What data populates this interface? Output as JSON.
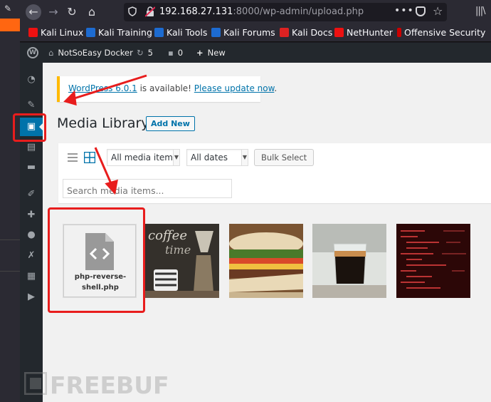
{
  "browser": {
    "url_host": "192.168.27.131",
    "url_path": ":8000/wp-admin/upload.php",
    "page_actions": "•••"
  },
  "bookmarks": [
    {
      "label": "Kali Linux",
      "icon": "kali-icon"
    },
    {
      "label": "Kali Training",
      "icon": "kali-training-icon"
    },
    {
      "label": "Kali Tools",
      "icon": "kali-tools-icon"
    },
    {
      "label": "Kali Forums",
      "icon": "kali-forums-icon"
    },
    {
      "label": "Kali Docs",
      "icon": "kali-docs-icon"
    },
    {
      "label": "NetHunter",
      "icon": "nethunter-icon"
    },
    {
      "label": "Offensive Security",
      "icon": "offsec-icon"
    }
  ],
  "admin_bar": {
    "site_name": "NotSoEasy Docker",
    "updates_count": "5",
    "comments_count": "0",
    "new_label": "New"
  },
  "notice": {
    "link1": "WordPress 6.0.1",
    "middle": " is available! ",
    "link2": "Please update now",
    "end": "."
  },
  "page": {
    "title": "Media Library",
    "add_new": "Add New"
  },
  "filters": {
    "media_type": "All media items",
    "dates": "All dates",
    "bulk_select": "Bulk Select",
    "search_placeholder": "Search media items..."
  },
  "media": {
    "file_name": "php-reverse-shell.php",
    "thumbnails": [
      "coffee",
      "sandwich",
      "espresso",
      "code"
    ]
  },
  "colors": {
    "wp_blue": "#0073aa",
    "admin_dark": "#23282d",
    "annotation_red": "#e81d1d",
    "notice_yellow": "#ffb900"
  },
  "watermark": "FREEBUF"
}
